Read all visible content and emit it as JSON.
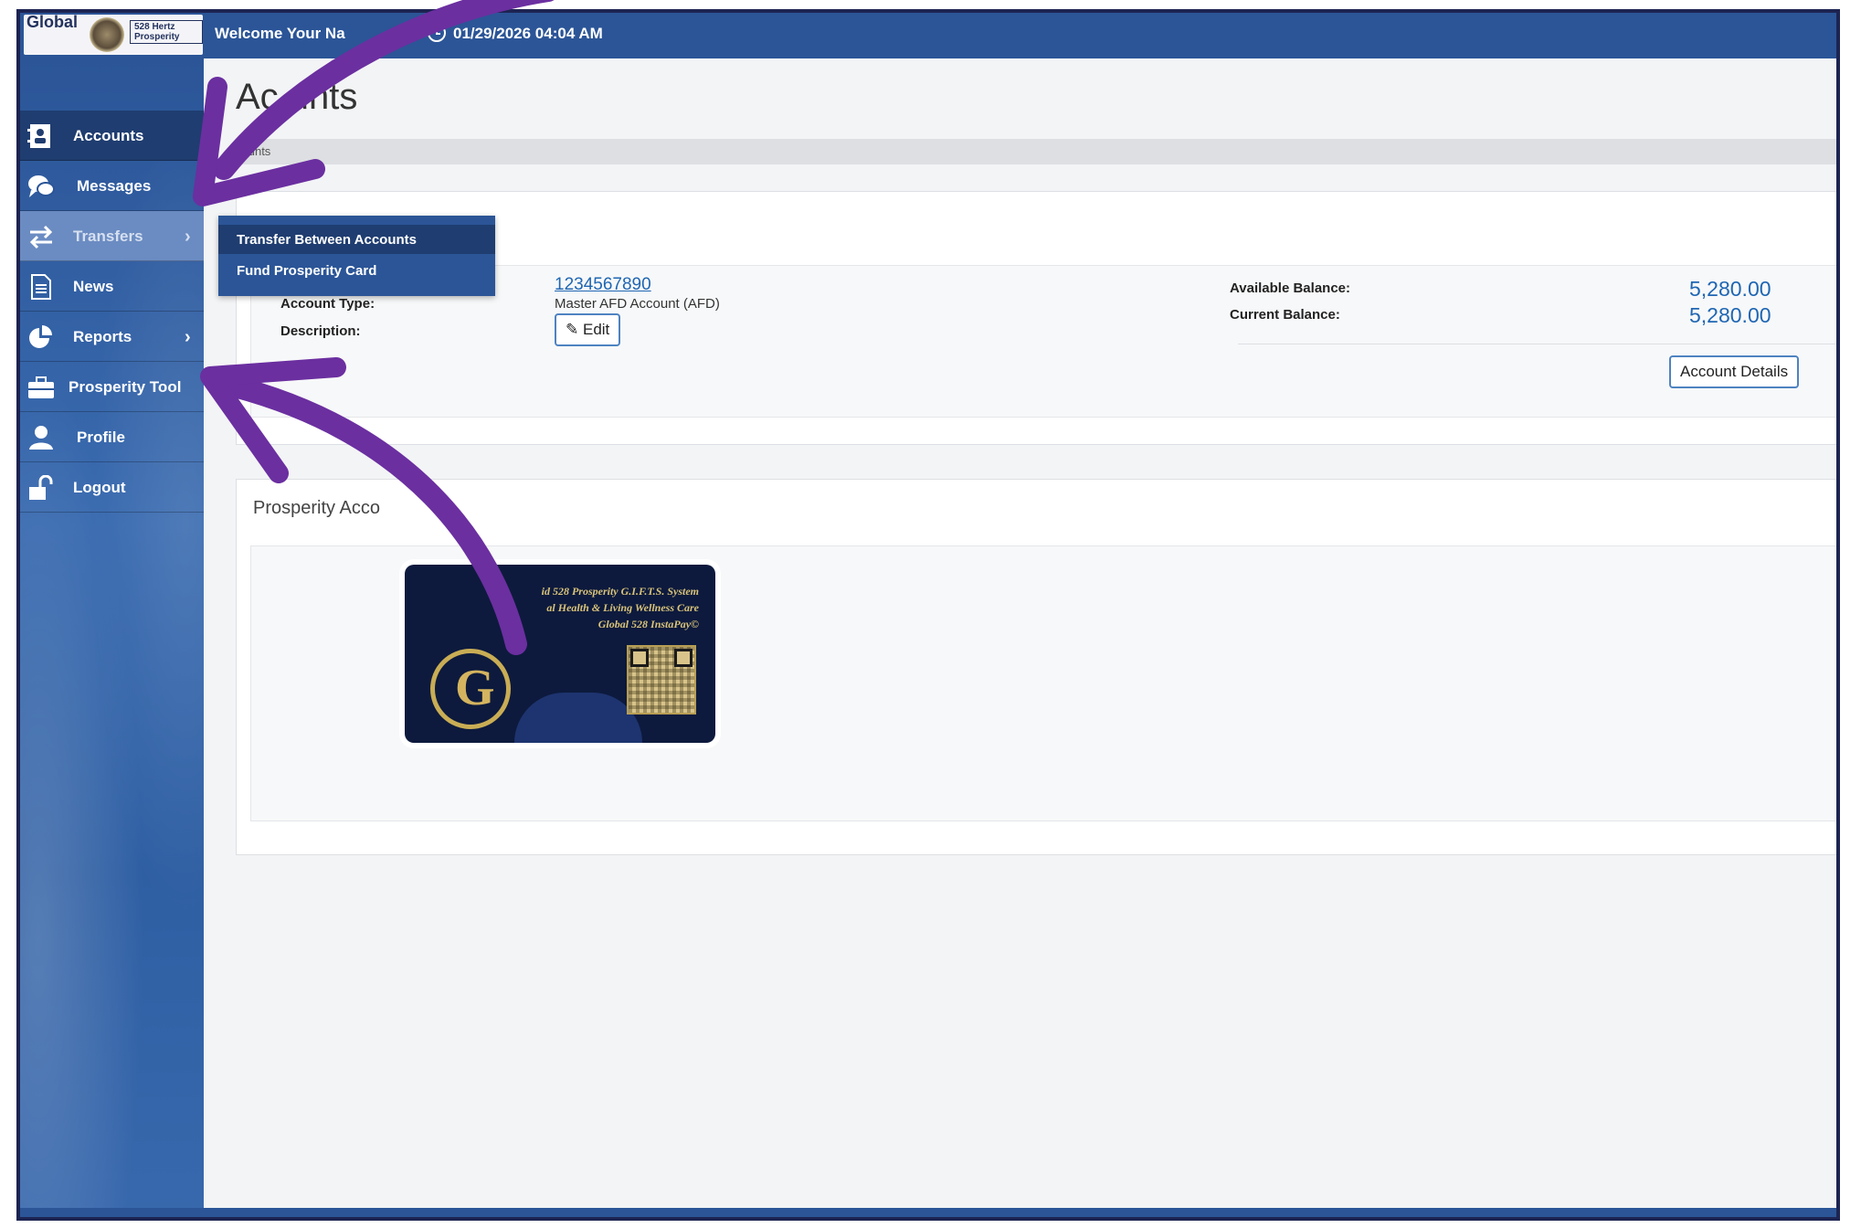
{
  "header": {
    "logo_text": "Global",
    "logo_sub": "528 Hertz Prosperity",
    "welcome": "Welcome  Your Na",
    "datetime": "01/29/2026 04:04 AM"
  },
  "sidebar": {
    "items": [
      {
        "label": "Accounts",
        "icon": "contact-card-icon"
      },
      {
        "label": "Messages",
        "icon": "chat-bubbles-icon"
      },
      {
        "label": "Transfers",
        "icon": "transfer-arrows-icon"
      },
      {
        "label": "News",
        "icon": "document-icon"
      },
      {
        "label": "Reports",
        "icon": "pie-chart-icon"
      },
      {
        "label": "Prosperity Tool",
        "icon": "briefcase-icon"
      },
      {
        "label": "Profile",
        "icon": "user-icon"
      },
      {
        "label": "Logout",
        "icon": "unlock-icon"
      }
    ]
  },
  "flyout": {
    "items": [
      "Transfer Between Accounts",
      "Fund Prosperity Card"
    ]
  },
  "main": {
    "title": "Ac     unts",
    "breadcrumb": "counts",
    "account": {
      "number": "1234567890",
      "type_label": "Account Type:",
      "type_value": "Master AFD Account (AFD)",
      "description_label": "Description:",
      "edit_label": "Edit",
      "available_label": "Available Balance:",
      "available_value": "5,280.00",
      "current_label": "Current Balance:",
      "current_value": "5,280.00",
      "details_button": "Account Details"
    },
    "prosperity": {
      "title": "Prosperity Acco",
      "card_lines": [
        "id 528 Prosperity G.I.F.T.S. System",
        "al Health & Living Wellness Care",
        "Global 528 InstaPay©"
      ]
    }
  },
  "colors": {
    "brand_blue": "#2b5597",
    "active_nav": "#1f3d70",
    "link_blue": "#1f66b3",
    "annotation_arrow": "#6b2fa0"
  }
}
